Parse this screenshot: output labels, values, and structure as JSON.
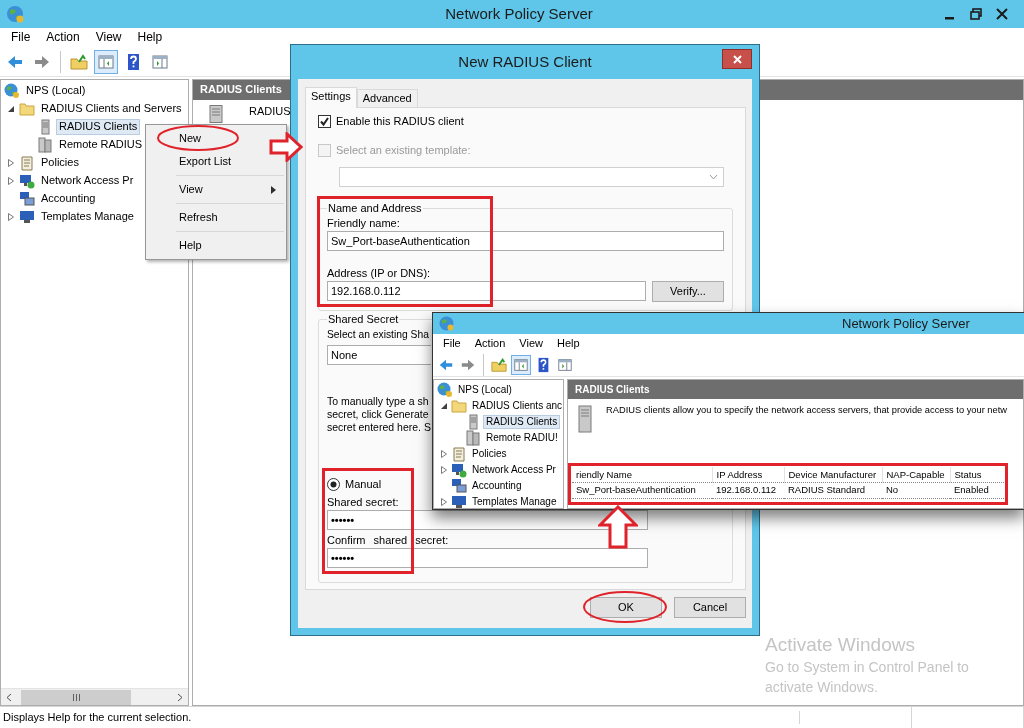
{
  "window": {
    "title": "Network Policy Server",
    "menu": [
      "File",
      "Action",
      "View",
      "Help"
    ],
    "toolbar": [
      {
        "kind": "back",
        "pressed": false
      },
      {
        "kind": "forward",
        "pressed": false
      },
      {
        "kind": "separator"
      },
      {
        "kind": "up",
        "pressed": false
      },
      {
        "kind": "tree",
        "pressed": true
      },
      {
        "kind": "help",
        "pressed": false
      },
      {
        "kind": "action",
        "pressed": false
      }
    ]
  },
  "tree": [
    {
      "label": "NPS (Local)",
      "kind": "root",
      "selected": false,
      "children": [
        {
          "label": "RADIUS Clients and Servers",
          "kind": "folder",
          "expanded": true,
          "selected": false,
          "children": [
            {
              "label": "RADIUS Clients",
              "kind": "clients",
              "selected": true
            },
            {
              "label": "Remote RADIUS",
              "kind": "remote",
              "selected": false
            }
          ]
        },
        {
          "label": "Policies",
          "kind": "policies",
          "expanded": false,
          "selected": false
        },
        {
          "label": "Network Access Pr",
          "kind": "nap",
          "expanded": false,
          "selected": false
        },
        {
          "label": "Accounting",
          "kind": "accounting",
          "selected": false
        },
        {
          "label": "Templates Manage",
          "kind": "templates",
          "expanded": false,
          "selected": false
        }
      ]
    }
  ],
  "pane": {
    "title": "RADIUS Clients",
    "item": "RADIUS"
  },
  "context_menu": [
    {
      "kind": "item",
      "label": "New",
      "circled": true
    },
    {
      "kind": "item",
      "label": "Export List"
    },
    {
      "kind": "separator"
    },
    {
      "kind": "submenu",
      "label": "View"
    },
    {
      "kind": "separator"
    },
    {
      "kind": "item",
      "label": "Refresh"
    },
    {
      "kind": "separator"
    },
    {
      "kind": "item",
      "label": "Help"
    }
  ],
  "annotations": [
    {
      "kind": "arrow-right"
    },
    {
      "kind": "arrow-up"
    }
  ],
  "dialog": {
    "title": "New RADIUS Client",
    "tabs": [
      {
        "label": "Settings",
        "selected": true
      },
      {
        "label": "Advanced",
        "selected": false
      }
    ],
    "enable": {
      "label": "Enable this RADIUS client",
      "checked": true,
      "disabled": false
    },
    "template": {
      "label": "Select an existing template:",
      "checked": false,
      "disabled": true
    },
    "name_address": {
      "title": "Name and Address",
      "outlined": true,
      "friendly_label": "Friendly name:",
      "friendly_value": "Sw_Port-baseAuthentication",
      "address_label": "Address (IP or DNS):",
      "address_value": "192.168.0.112",
      "verify": "Verify..."
    },
    "shared_secret": {
      "title": "Shared Secret",
      "select_label": "Select an existing Sha",
      "select_value": "None",
      "help_lines": [
        "To manually type a sh",
        "secret, click Generate",
        "secret entered here. S"
      ],
      "manual": {
        "label": "Manual",
        "selected": true,
        "outlined": true
      },
      "secret_label": "Shared secret:",
      "secret_value": "••••••",
      "confirm_label": "Confirm shared secret:",
      "confirm_value": "••••••"
    },
    "buttons": [
      {
        "label": "OK",
        "circled": true
      },
      {
        "label": "Cancel",
        "circled": false
      }
    ]
  },
  "inset": {
    "title": "Network Policy Server",
    "menu": [
      "File",
      "Action",
      "View",
      "Help"
    ],
    "toolbar": [
      {
        "kind": "back",
        "pressed": false
      },
      {
        "kind": "forward",
        "pressed": false
      },
      {
        "kind": "separator"
      },
      {
        "kind": "up",
        "pressed": false
      },
      {
        "kind": "tree",
        "pressed": true
      },
      {
        "kind": "help",
        "pressed": false
      },
      {
        "kind": "action",
        "pressed": false
      }
    ],
    "tree": [
      {
        "label": "NPS (Local)",
        "kind": "root",
        "selected": false,
        "children": [
          {
            "label": "RADIUS Clients anc",
            "kind": "folder",
            "expanded": true,
            "selected": false,
            "children": [
              {
                "label": "RADIUS Clients",
                "kind": "clients",
                "selected": true
              },
              {
                "label": "Remote RADIU!",
                "kind": "remote",
                "selected": false
              }
            ]
          },
          {
            "label": "Policies",
            "kind": "policies",
            "expanded": false,
            "selected": false
          },
          {
            "label": "Network Access Pr",
            "kind": "nap",
            "expanded": false,
            "selected": false
          },
          {
            "label": "Accounting",
            "kind": "accounting",
            "selected": false
          },
          {
            "label": "Templates Manage",
            "kind": "templates",
            "expanded": false,
            "selected": false
          }
        ]
      }
    ],
    "pane_title": "RADIUS Clients",
    "description": "RADIUS clients allow you to specify the network access servers, that provide access to your netw",
    "table": {
      "outlined": true,
      "columns": [
        "riendly Name",
        "IP Address",
        "Device Manufacturer",
        "NAP-Capable",
        "Status"
      ],
      "rows": [
        {
          "cells": [
            "Sw_Port-baseAuthentication",
            "192.168.0.112",
            "RADIUS Standard",
            "No",
            "Enabled"
          ],
          "focused": true
        }
      ]
    }
  },
  "status_bar": "Displays Help for the current selection.",
  "activation_notice": {
    "title": "Activate Windows",
    "text": "Go to System in Control Panel to activate Windows."
  }
}
